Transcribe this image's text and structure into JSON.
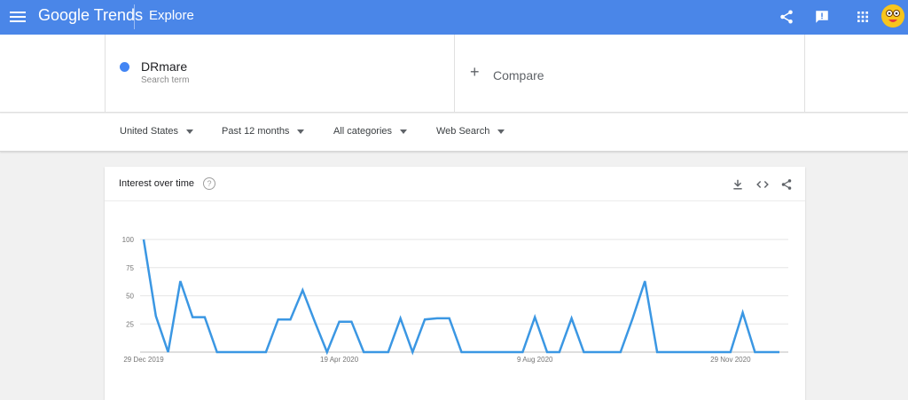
{
  "header": {
    "logo": "Google Trends",
    "section": "Explore",
    "icons": [
      "menu-icon",
      "share-icon",
      "feedback-icon",
      "apps-icon",
      "avatar"
    ]
  },
  "search_terms": [
    {
      "name": "DRmare",
      "subtitle": "Search term",
      "color": "#4285f4"
    }
  ],
  "compare": {
    "label": "Compare"
  },
  "filters": {
    "region": "United States",
    "time": "Past 12 months",
    "category": "All categories",
    "search_type": "Web Search"
  },
  "card": {
    "title": "Interest over time",
    "actions": [
      "download-icon",
      "embed-icon",
      "share-icon"
    ]
  },
  "colors": {
    "header": "#4a86e8",
    "series": "#3b97e3"
  },
  "chart_data": {
    "type": "line",
    "x_tick_labels": [
      "29 Dec 2019",
      "19 Apr 2020",
      "9 Aug 2020",
      "29 Nov 2020"
    ],
    "x_tick_index": [
      0,
      16,
      32,
      48
    ],
    "y_ticks": [
      25,
      50,
      75,
      100
    ],
    "ylim": [
      0,
      100
    ],
    "grid": true,
    "series": [
      {
        "values": [
          100,
          32,
          0,
          63,
          31,
          31,
          0,
          0,
          0,
          0,
          0,
          29,
          29,
          55,
          27,
          0,
          27,
          27,
          0,
          0,
          0,
          30,
          0,
          29,
          30,
          30,
          0,
          0,
          0,
          0,
          0,
          0,
          31,
          0,
          0,
          30,
          0,
          0,
          0,
          0,
          30,
          63,
          0,
          0,
          0,
          0,
          0,
          0,
          0,
          35,
          0,
          0,
          0
        ]
      }
    ]
  }
}
